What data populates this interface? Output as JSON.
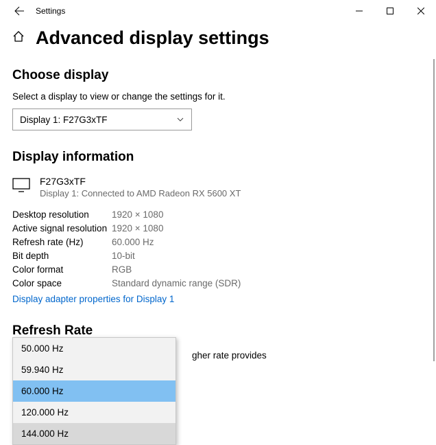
{
  "app": {
    "title": "Settings"
  },
  "page": {
    "heading": "Advanced display settings"
  },
  "choose": {
    "heading": "Choose display",
    "subtext": "Select a display to view or change the settings for it.",
    "selected": "Display 1: F27G3xTF"
  },
  "info": {
    "heading": "Display information",
    "monitor_name": "F27G3xTF",
    "monitor_sub": "Display 1: Connected to AMD Radeon RX 5600 XT",
    "rows": [
      {
        "label": "Desktop resolution",
        "value": "1920 × 1080"
      },
      {
        "label": "Active signal resolution",
        "value": "1920 × 1080"
      },
      {
        "label": "Refresh rate (Hz)",
        "value": "60.000 Hz"
      },
      {
        "label": "Bit depth",
        "value": "10-bit"
      },
      {
        "label": "Color format",
        "value": "RGB"
      },
      {
        "label": "Color space",
        "value": "Standard dynamic range (SDR)"
      }
    ],
    "link": "Display adapter properties for Display 1"
  },
  "refresh": {
    "heading": "Refresh Rate",
    "partial_visible": "gher rate provides",
    "options": [
      "50.000 Hz",
      "59.940 Hz",
      "60.000 Hz",
      "120.000 Hz",
      "144.000 Hz"
    ],
    "selected_index": 2,
    "hover_index": 4
  }
}
